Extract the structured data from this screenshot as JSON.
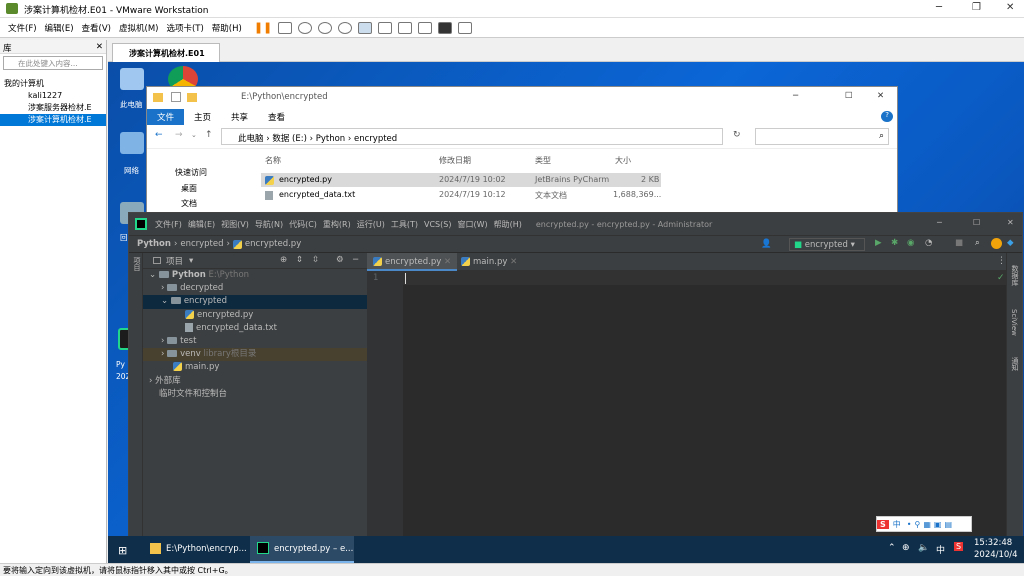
{
  "vm": {
    "title": "涉案计算机检材.E01 - VMware Workstation",
    "menu": [
      "文件(F)",
      "编辑(E)",
      "查看(V)",
      "虚拟机(M)",
      "选项卡(T)",
      "帮助(H)"
    ],
    "library_title": "库",
    "search_placeholder": "在此处键入内容...",
    "tree": [
      "我的计算机",
      "kali1227",
      "涉案服务器检材.E",
      "涉案计算机检材.E"
    ],
    "tab": "涉案计算机检材.E01",
    "status": "要将输入定向到该虚拟机，请将鼠标指针移入其中或按 Ctrl+G。"
  },
  "desktop": {
    "icons": [
      "此电脑",
      "网络",
      "回",
      "Py",
      "202"
    ]
  },
  "explorer": {
    "path": "E:\\Python\\encrypted",
    "ribbon": [
      "文件",
      "主页",
      "共享",
      "查看"
    ],
    "breadcrumb": [
      "此电脑",
      "数据 (E:)",
      "Python",
      "encrypted"
    ],
    "quick": [
      "快速访问",
      "桌面",
      "文档"
    ],
    "headers": [
      "名称",
      "修改日期",
      "类型",
      "大小"
    ],
    "files": [
      {
        "name": "encrypted.py",
        "date": "2024/7/19 10:02",
        "type": "JetBrains PyCharm",
        "size": "2 KB"
      },
      {
        "name": "encrypted_data.txt",
        "date": "2024/7/19 10:12",
        "type": "文本文档",
        "size": "1,688,369..."
      }
    ]
  },
  "pycharm": {
    "menu": [
      "文件(F)",
      "编辑(E)",
      "视图(V)",
      "导航(N)",
      "代码(C)",
      "重构(R)",
      "运行(U)",
      "工具(T)",
      "VCS(S)",
      "窗口(W)",
      "帮助(H)"
    ],
    "title": "encrypted.py - encrypted.py - Administrator",
    "breadcrumb": [
      "Python",
      "encrypted",
      "encrypted.py"
    ],
    "run_config": "encrypted",
    "project_label": "项目",
    "tree": [
      {
        "t": "Python",
        "x": "E:\\Python"
      },
      {
        "t": "decrypted"
      },
      {
        "t": "encrypted"
      },
      {
        "t": "encrypted.py"
      },
      {
        "t": "encrypted_data.txt"
      },
      {
        "t": "test"
      },
      {
        "t": "venv",
        "x": "library根目录"
      },
      {
        "t": "main.py"
      },
      {
        "t": "外部库"
      },
      {
        "t": "临时文件和控制台"
      }
    ],
    "tabs": [
      "encrypted.py",
      "main.py"
    ],
    "line": "1",
    "left_tool": "项目",
    "right_tools": [
      "数据库",
      "SciView",
      "通知"
    ]
  },
  "taskbar": {
    "items": [
      "E:\\Python\\encryp...",
      "encrypted.py – e..."
    ],
    "time": "15:32:48",
    "date": "2024/10/4",
    "ime": "中"
  },
  "colors": {
    "desktop": "#0b66d6",
    "accent": "#0078d7"
  }
}
